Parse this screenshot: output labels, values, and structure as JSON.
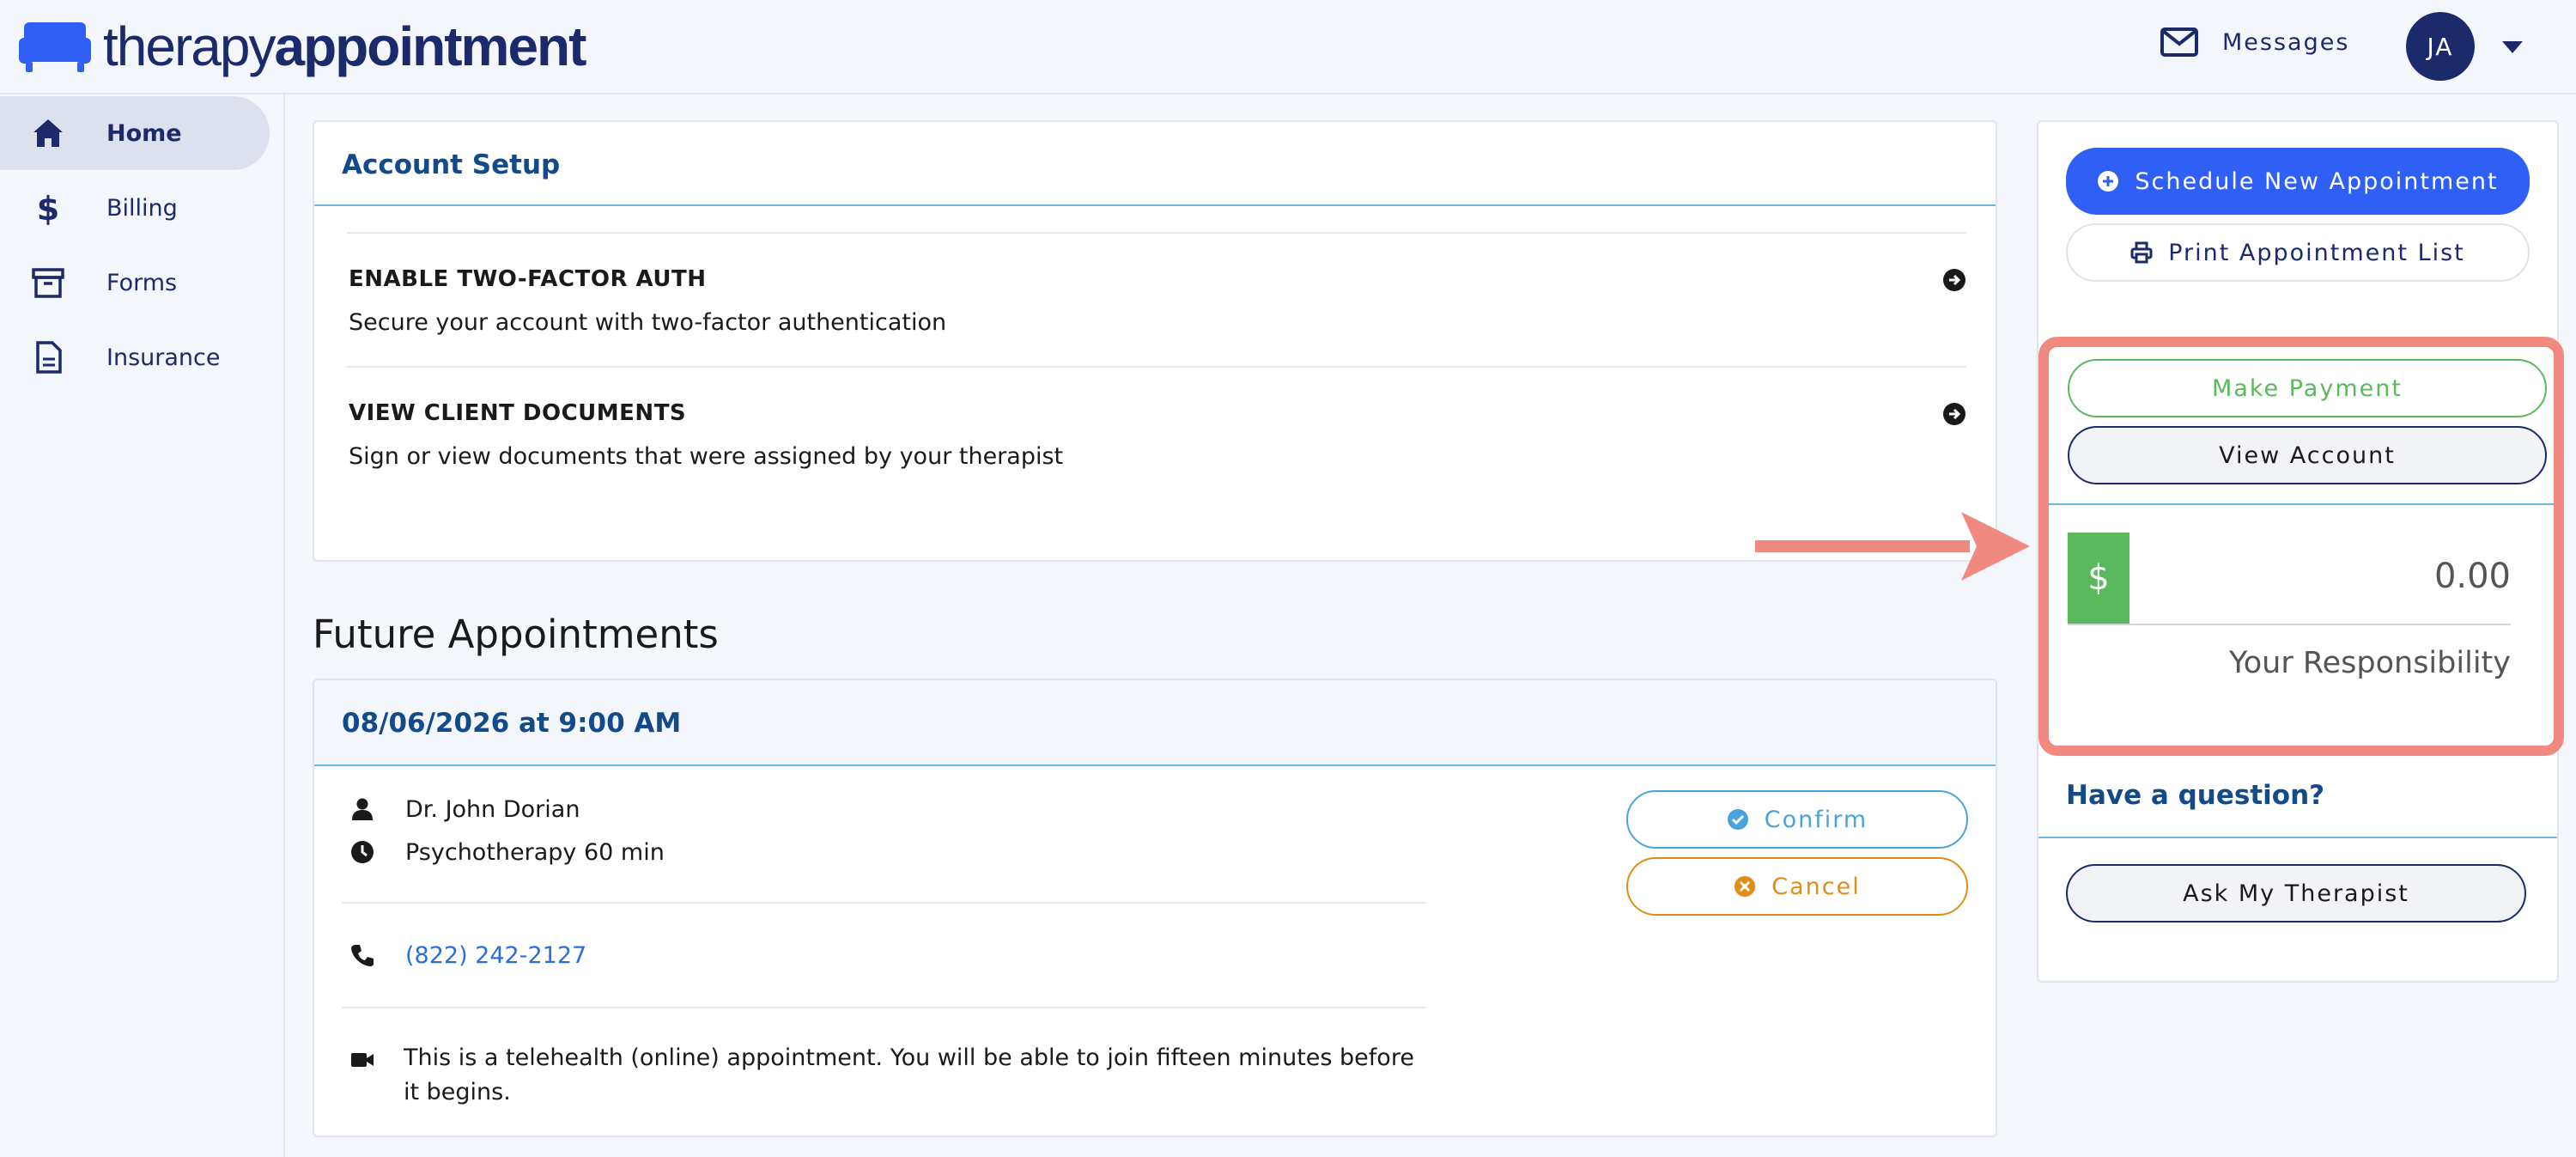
{
  "header": {
    "logo_light": "therapy",
    "logo_bold": "appointment",
    "messages_label": "Messages",
    "avatar_initials": "JA"
  },
  "sidebar": {
    "items": [
      {
        "label": "Home",
        "icon": "home-icon",
        "active": true
      },
      {
        "label": "Billing",
        "icon": "dollar-icon"
      },
      {
        "label": "Forms",
        "icon": "archive-icon"
      },
      {
        "label": "Insurance",
        "icon": "document-icon"
      }
    ]
  },
  "account_setup": {
    "title": "Account Setup",
    "rows": [
      {
        "title": "ENABLE TWO-FACTOR AUTH",
        "desc": "Secure your account with two-factor authentication"
      },
      {
        "title": "VIEW CLIENT DOCUMENTS",
        "desc": "Sign or view documents that were assigned by your therapist"
      }
    ]
  },
  "future": {
    "title": "Future Appointments",
    "appointment": {
      "datetime": "08/06/2026 at 9:00 AM",
      "provider": "Dr. John Dorian",
      "service": "Psychotherapy 60 min",
      "phone": "(822) 242-2127",
      "telehealth_note": "This is a telehealth (online) appointment. You will be able to join fifteen minutes before it begins.",
      "confirm_label": "Confirm",
      "cancel_label": "Cancel"
    }
  },
  "right_panel": {
    "schedule_label": "Schedule New Appointment",
    "print_label": "Print Appointment List",
    "make_payment_label": "Make Payment",
    "view_account_label": "View Account",
    "currency_symbol": "$",
    "amount": "0.00",
    "responsibility_label": "Your Responsibility",
    "question_title": "Have a question?",
    "ask_label": "Ask My Therapist"
  },
  "colors": {
    "brand": "#1b2a6b",
    "primary": "#2f5ff5",
    "success": "#5bb85c",
    "warning": "#e08e16",
    "info": "#4aa3df",
    "highlight": "#f08a80"
  }
}
